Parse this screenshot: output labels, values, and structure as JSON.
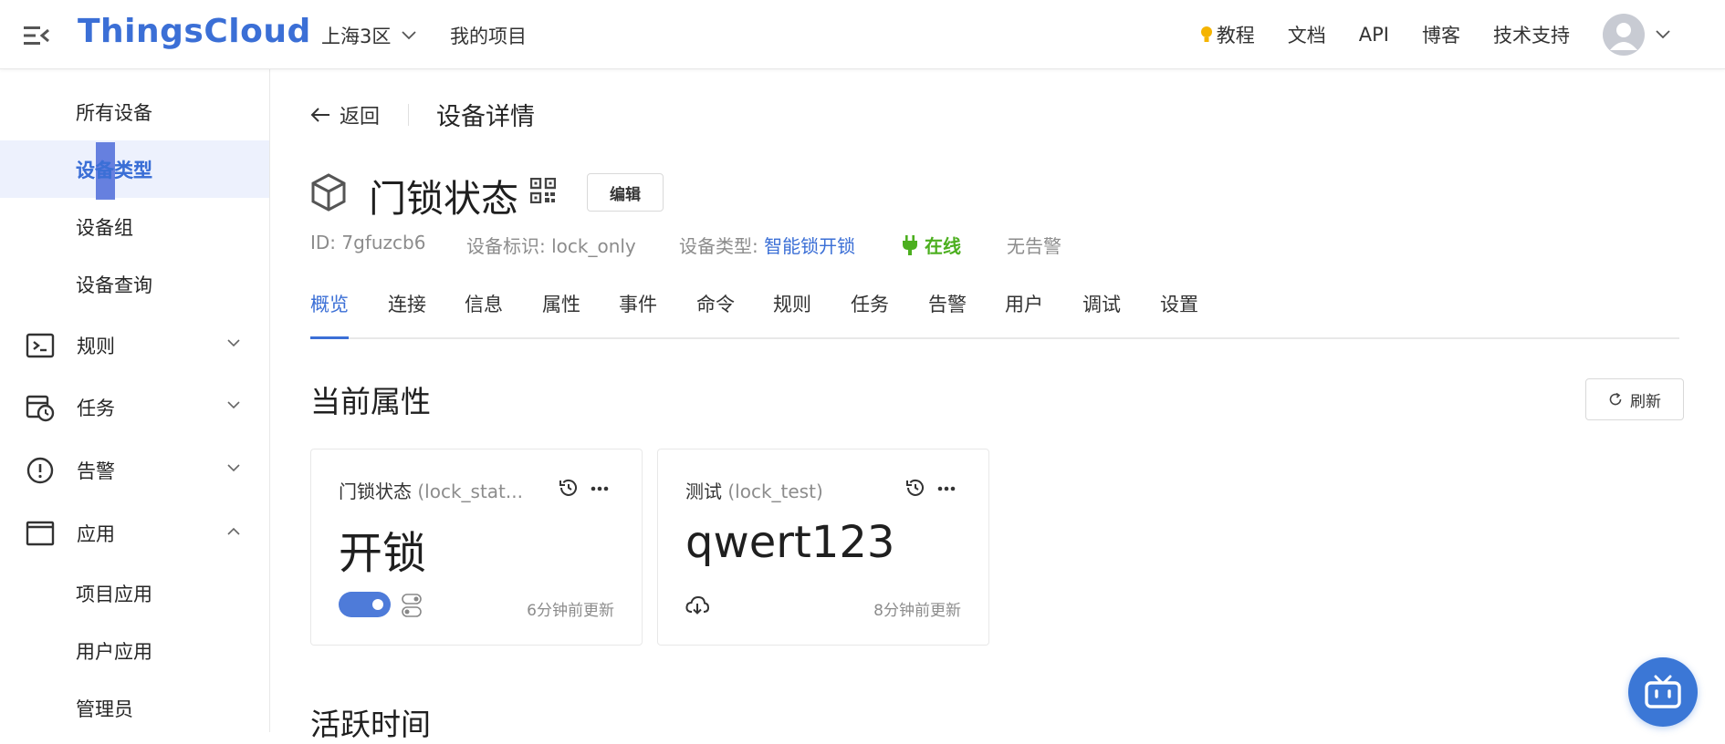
{
  "header": {
    "logo": "ThingsCloud",
    "region": "上海3区",
    "my_projects": "我的项目",
    "links": {
      "tutorial": "教程",
      "docs": "文档",
      "api": "API",
      "blog": "博客",
      "support": "技术支持"
    }
  },
  "sidebar": {
    "device_items": [
      "所有设备",
      "设备类型",
      "设备组",
      "设备查询"
    ],
    "groups": {
      "rules": "规则",
      "tasks": "任务",
      "alarms": "告警",
      "apps": "应用"
    },
    "app_items": [
      "项目应用",
      "用户应用",
      "管理员"
    ]
  },
  "breadcrumb": {
    "back": "返回",
    "title": "设备详情"
  },
  "device": {
    "name": "门锁状态",
    "edit_label": "编辑",
    "id": "ID: 7gfuzcb6",
    "identifier": "设备标识: lock_only",
    "type_label": "设备类型: ",
    "type_value": "智能锁开锁",
    "status": "在线",
    "alarm": "无告警"
  },
  "tabs": [
    "概览",
    "连接",
    "信息",
    "属性",
    "事件",
    "命令",
    "规则",
    "任务",
    "告警",
    "用户",
    "调试",
    "设置"
  ],
  "properties": {
    "section_title": "当前属性",
    "refresh_label": "刷新",
    "cards": [
      {
        "name": "门锁状态",
        "key": "(lock_stat...",
        "value": "开锁",
        "updated": "6分钟前更新"
      },
      {
        "name": "测试",
        "key": "(lock_test)",
        "value": "qwert123",
        "updated": "8分钟前更新"
      }
    ]
  },
  "active_time_title": "活跃时间",
  "colors": {
    "brand": "#3b6fd6",
    "online": "#4caf1f",
    "sidebar_active_bg": "#edf1fd"
  }
}
